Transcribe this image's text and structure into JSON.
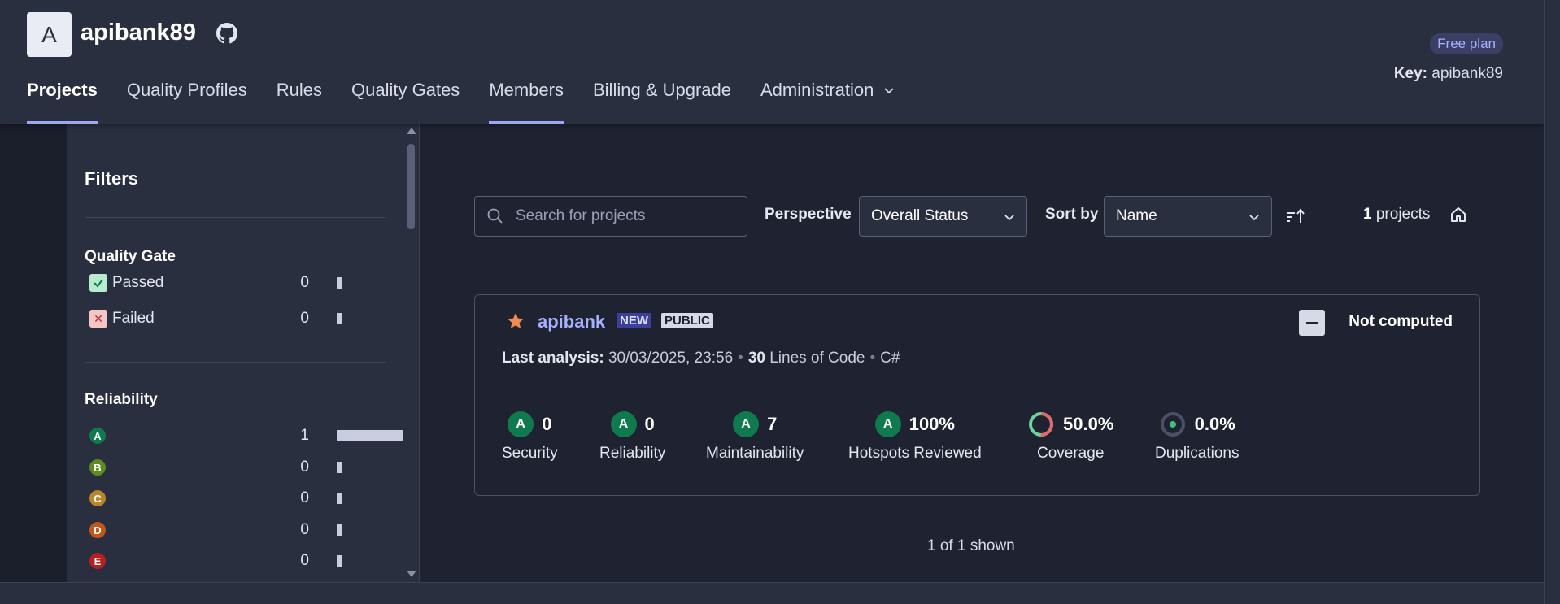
{
  "org": {
    "avatar_letter": "A",
    "name": "apibank89",
    "github_icon": "github-icon"
  },
  "nav": {
    "projects": "Projects",
    "quality_profiles": "Quality Profiles",
    "rules": "Rules",
    "quality_gates": "Quality Gates",
    "members": "Members",
    "billing": "Billing & Upgrade",
    "administration": "Administration"
  },
  "plan": {
    "badge": "Free plan",
    "key_label": "Key:",
    "key_value": "apibank89"
  },
  "filters": {
    "title": "Filters",
    "quality_gate": {
      "title": "Quality Gate",
      "items": [
        {
          "label": "Passed",
          "count": "0",
          "fraction": 0
        },
        {
          "label": "Failed",
          "count": "0",
          "fraction": 0
        }
      ]
    },
    "reliability": {
      "title": "Reliability",
      "items": [
        {
          "grade": "A",
          "count": "1",
          "fraction": 1,
          "color": "#0f7a4d"
        },
        {
          "grade": "B",
          "count": "0",
          "fraction": 0,
          "color": "#5f8a1f"
        },
        {
          "grade": "C",
          "count": "0",
          "fraction": 0,
          "color": "#b8862b"
        },
        {
          "grade": "D",
          "count": "0",
          "fraction": 0,
          "color": "#c2571a"
        },
        {
          "grade": "E",
          "count": "0",
          "fraction": 0,
          "color": "#b52020"
        }
      ]
    }
  },
  "toolbar": {
    "search_placeholder": "Search for projects",
    "perspective_label": "Perspective",
    "perspective_value": "Overall Status",
    "sort_label": "Sort by",
    "sort_value": "Name",
    "project_count": "1",
    "project_count_suffix": " projects"
  },
  "project": {
    "name": "apibank",
    "tag_new": "NEW",
    "tag_public": "PUBLIC",
    "status": "Not computed",
    "analysis_label": "Last analysis:",
    "analysis_date": "30/03/2025, 23:56",
    "loc_value": "30",
    "loc_label": "Lines of Code",
    "language": "C#",
    "metrics": {
      "security": {
        "grade": "A",
        "value": "0",
        "label": "Security"
      },
      "reliability": {
        "grade": "A",
        "value": "0",
        "label": "Reliability"
      },
      "maintainability": {
        "grade": "A",
        "value": "7",
        "label": "Maintainability"
      },
      "hotspots": {
        "grade": "A",
        "value": "100%",
        "label": "Hotspots Reviewed"
      },
      "coverage": {
        "value": "50.0%",
        "label": "Coverage",
        "fraction": 0.5
      },
      "duplications": {
        "value": "0.0%",
        "label": "Duplications"
      }
    }
  },
  "footer": {
    "shown": "1 of 1 shown"
  },
  "colors": {
    "accent": "#9fa7f2",
    "grade_a": "#0f7a4d",
    "link": "#a7b0ff"
  }
}
